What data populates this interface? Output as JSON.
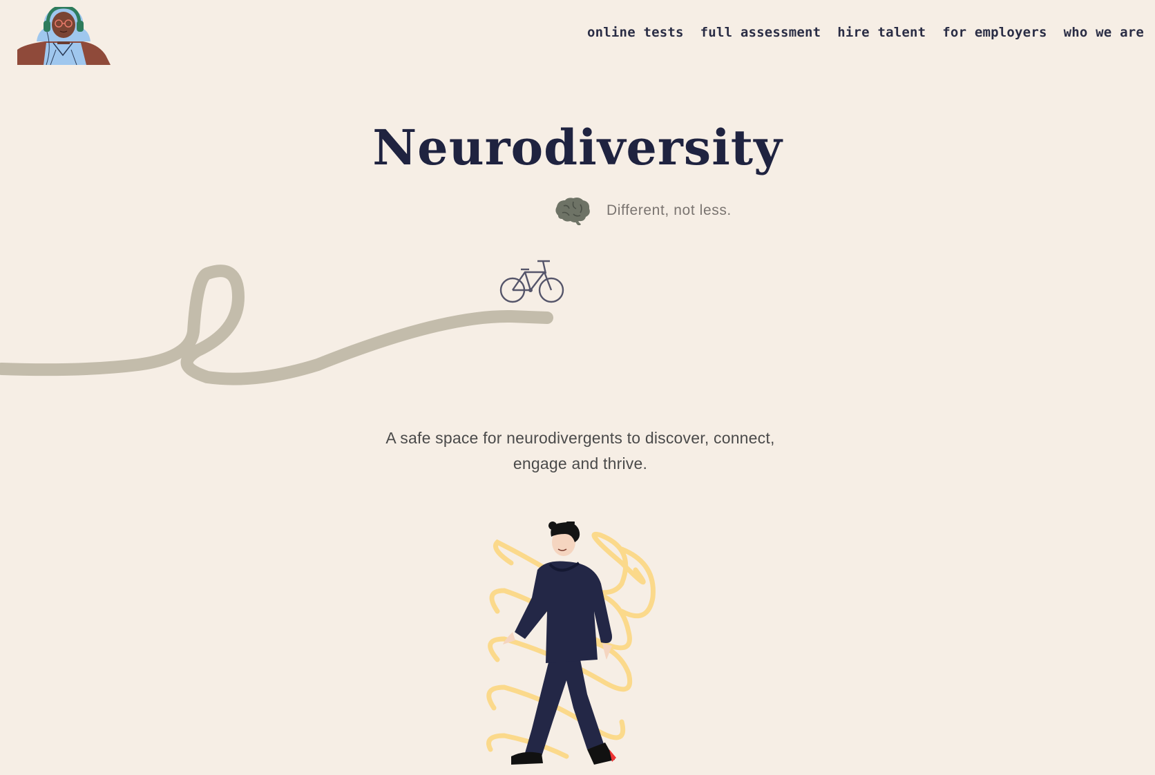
{
  "nav": {
    "items": [
      {
        "label": "online tests"
      },
      {
        "label": "full assessment"
      },
      {
        "label": "hire talent"
      },
      {
        "label": "for employers"
      },
      {
        "label": "who we are"
      }
    ]
  },
  "hero": {
    "title": "Neurodiversity",
    "tagline": "Different, not less.",
    "intro_line1": "A safe space for neurodivergents to discover, connect,",
    "intro_line2": "engage and thrive."
  },
  "icons": {
    "logo": "woman-with-headphones-avatar",
    "brain": "brain-icon",
    "bike": "bicycle-icon",
    "illustration": "walking-person-illustration"
  },
  "colors": {
    "background": "#f6eee5",
    "navy": "#1f2340",
    "squiggle": "#c3bcab",
    "brain": "#6e7366",
    "scribble": "#fcd782"
  }
}
